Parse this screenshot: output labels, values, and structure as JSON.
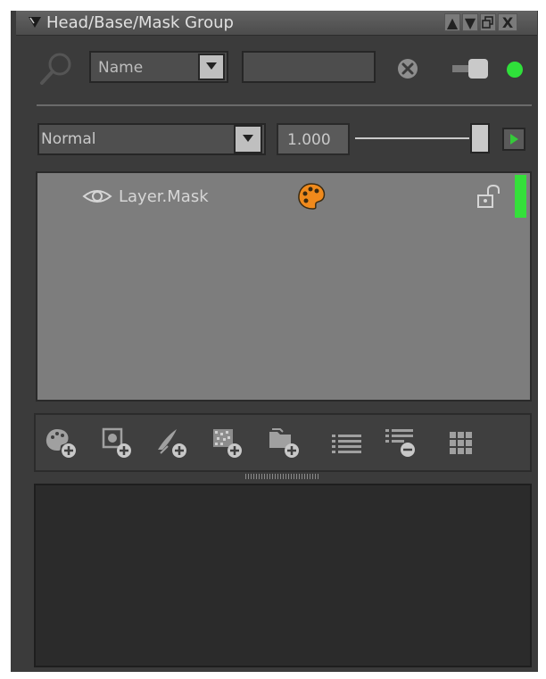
{
  "window": {
    "title": "Head/Base/Mask Group",
    "buttons": {
      "up": "▲",
      "down": "▼",
      "restore": "🗗",
      "close": "X"
    }
  },
  "search": {
    "filter_value": "Name",
    "query_value": "",
    "icons": [
      "search-icon",
      "clear-icon",
      "toggle-icon",
      "status-dot-icon"
    ]
  },
  "blend": {
    "mode_value": "Normal",
    "opacity_value": "1.000",
    "slider_level": 1.0
  },
  "layers": [
    {
      "name": "Layer.Mask",
      "visible": true,
      "icons": [
        "eye-icon",
        "palette-icon",
        "lock-icon"
      ]
    }
  ],
  "toolbar": {
    "icons": [
      "add-paint-layer-icon",
      "add-mask-icon",
      "add-brush-layer-icon",
      "add-noise-layer-icon",
      "add-folder-icon",
      "list-icon",
      "remove-list-icon",
      "grid-icon"
    ]
  },
  "colors": {
    "panel_bg": "#3b3b3b",
    "layer_bg": "#7d7d7d",
    "accent_green": "#35e03a",
    "palette_orange": "#f08a1c"
  }
}
